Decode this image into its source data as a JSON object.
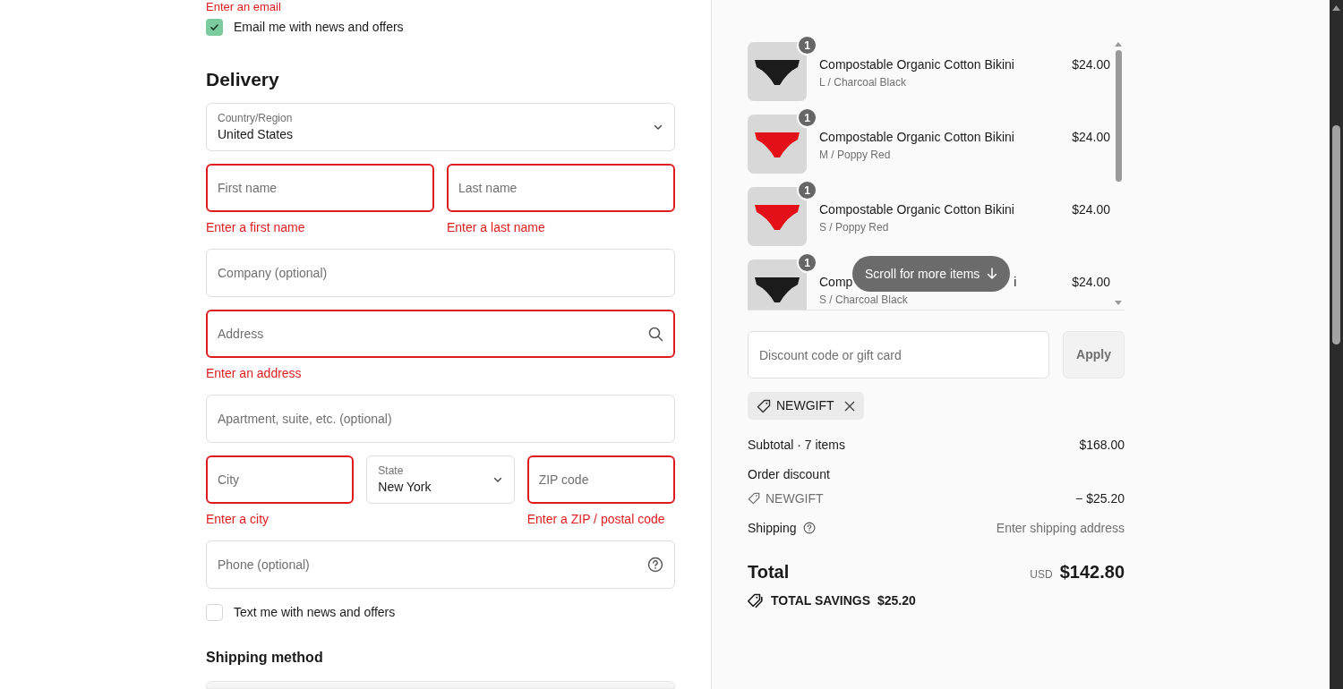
{
  "contact_error": "Enter an email",
  "email_opt_in": {
    "label": "Email me with news and offers",
    "checked": true
  },
  "delivery": {
    "title": "Delivery",
    "rows": [
      {
        "fields": [
          {
            "kind": "select",
            "label": "Country/Region",
            "value": "United States",
            "invalid": false
          }
        ]
      },
      {
        "fields": [
          {
            "kind": "text",
            "placeholder": "First name",
            "invalid": true,
            "error": "Enter a first name"
          },
          {
            "kind": "text",
            "placeholder": "Last name",
            "invalid": true,
            "error": "Enter a last name"
          }
        ]
      },
      {
        "fields": [
          {
            "kind": "text",
            "placeholder": "Company (optional)",
            "invalid": false
          }
        ]
      },
      {
        "fields": [
          {
            "kind": "address",
            "placeholder": "Address",
            "invalid": true,
            "error": "Enter an address"
          }
        ]
      },
      {
        "fields": [
          {
            "kind": "text",
            "placeholder": "Apartment, suite, etc. (optional)",
            "invalid": false
          }
        ]
      },
      {
        "fields": [
          {
            "kind": "text",
            "placeholder": "City",
            "invalid": true,
            "error": "Enter a city"
          },
          {
            "kind": "select",
            "label": "State",
            "value": "New York",
            "invalid": false
          },
          {
            "kind": "text",
            "placeholder": "ZIP code",
            "invalid": true,
            "error": "Enter a ZIP / postal code"
          }
        ]
      },
      {
        "fields": [
          {
            "kind": "phone",
            "placeholder": "Phone (optional)",
            "invalid": false
          }
        ]
      }
    ]
  },
  "text_opt_in": {
    "label": "Text me with news and offers",
    "checked": false
  },
  "shipping_method": {
    "title": "Shipping method"
  },
  "cart": {
    "items": [
      {
        "quantity": "1",
        "name": "Compostable Organic Cotton Bikini",
        "variant": "L / Charcoal Black",
        "price": "$24.00"
      },
      {
        "quantity": "1",
        "name": "Compostable Organic Cotton Bikini",
        "variant": "M / Poppy Red",
        "price": "$24.00"
      },
      {
        "quantity": "1",
        "name": "Compostable Organic Cotton Bikini",
        "variant": "S / Poppy Red",
        "price": "$24.00"
      },
      {
        "quantity": "1",
        "name_start": "Comp",
        "name_end": "i",
        "variant": "S / Charcoal Black",
        "price": "$24.00"
      }
    ],
    "scroll_hint": "Scroll for more items"
  },
  "discount": {
    "placeholder": "Discount code or gift card",
    "button": "Apply",
    "applied_code": "NEWGIFT"
  },
  "summary": {
    "subtotal_label": "Subtotal · 7 items",
    "subtotal": "$168.00",
    "discount_label": "Order discount",
    "discount_code": "NEWGIFT",
    "discount_amount": "− $25.20",
    "shipping_label": "Shipping",
    "shipping_value": "Enter shipping address",
    "total_label": "Total",
    "currency": "USD",
    "total": "$142.80",
    "savings_label": "TOTAL SAVINGS",
    "savings": "$25.20"
  }
}
